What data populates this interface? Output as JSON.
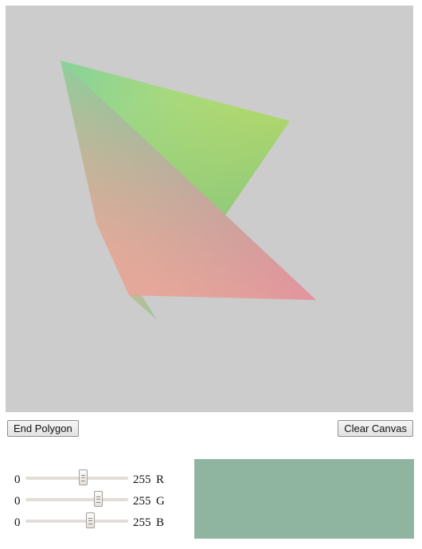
{
  "canvas": {
    "background": "#cccccc",
    "shapes": [
      {
        "name": "upper-triangle",
        "vertex_colors": [
          "#88d29a",
          "#c8e060",
          "#8cc87c"
        ]
      },
      {
        "name": "lower-triangle",
        "vertex_colors": [
          "#8cd09a",
          "#e08aa0",
          "#f0a898"
        ]
      },
      {
        "name": "sliver-triangle",
        "vertex_colors": [
          "#f0a898",
          "#e898a4",
          "#9cc898"
        ]
      }
    ]
  },
  "buttons": {
    "end_polygon": "End Polygon",
    "clear_canvas": "Clear Canvas"
  },
  "sliders": [
    {
      "channel": "R",
      "min": "0",
      "max": "255",
      "value": 143
    },
    {
      "channel": "G",
      "min": "0",
      "max": "255",
      "value": 180
    },
    {
      "channel": "B",
      "min": "0",
      "max": "255",
      "value": 161
    }
  ],
  "preview": {
    "color": "#8fb5a1"
  }
}
